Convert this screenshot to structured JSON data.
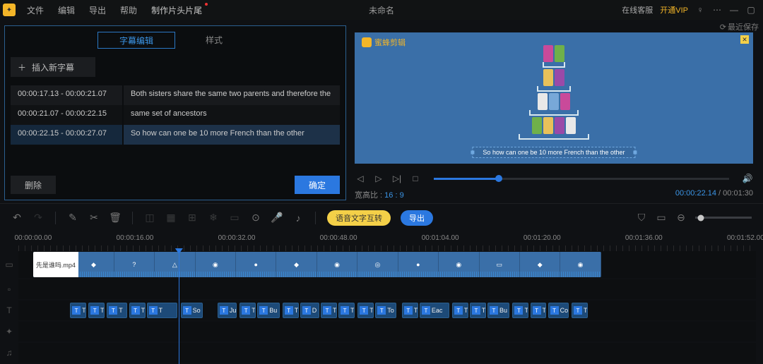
{
  "titlebar": {
    "menus": [
      "文件",
      "编辑",
      "导出",
      "帮助",
      "制作片头片尾"
    ],
    "doc_title": "未命名",
    "right": {
      "service": "在线客服",
      "vip": "开通VIP"
    }
  },
  "recent_save": "最近保存",
  "subtitle_panel": {
    "tabs": {
      "edit": "字幕编辑",
      "style": "样式"
    },
    "insert": "插入新字幕",
    "rows": [
      {
        "time": "00:00:17.13 - 00:00:21.07",
        "text": "Both sisters share the same two parents and therefore the"
      },
      {
        "time": "00:00:21.07 - 00:00:22.15",
        "text": "same set of ancestors"
      },
      {
        "time": "00:00:22.15 - 00:00:27.07",
        "text": "So how can one be 10 more French than the other"
      }
    ],
    "delete": "删除",
    "confirm": "确定"
  },
  "preview": {
    "watermark": "蜜蜂剪辑",
    "caption": "So how can one be 10 more French than the other"
  },
  "player": {
    "aspect_label": "宽高比",
    "aspect_value": "16 : 9",
    "current": "00:00:22.14",
    "total": "00:01:30"
  },
  "toolbar": {
    "voice_text": "语音文字互转",
    "export": "导出"
  },
  "ruler": [
    {
      "t": "00:00:00.00",
      "pct": 2
    },
    {
      "t": "00:00:16.00",
      "pct": 15.8
    },
    {
      "t": "00:00:32.00",
      "pct": 29.6
    },
    {
      "t": "00:00:48.00",
      "pct": 43.4
    },
    {
      "t": "00:01:04.00",
      "pct": 57.2
    },
    {
      "t": "00:01:20.00",
      "pct": 71.0
    },
    {
      "t": "00:01:36.00",
      "pct": 84.8
    },
    {
      "t": "00:01:52.00",
      "pct": 98.6
    }
  ],
  "playhead_pct": 21.2,
  "video_track": {
    "label": "先是谁吗.mp4",
    "start_pct": 2,
    "width_pct": 77
  },
  "text_clips": [
    {
      "l": 7,
      "w": 2.2,
      "t": "T"
    },
    {
      "l": 9.5,
      "w": 2.2,
      "t": "T"
    },
    {
      "l": 12,
      "w": 2.8,
      "t": "T"
    },
    {
      "l": 15,
      "w": 2.2,
      "t": "T"
    },
    {
      "l": 17.4,
      "w": 4.2,
      "t": "T"
    },
    {
      "l": 22,
      "w": 3,
      "t": "So"
    },
    {
      "l": 27,
      "w": 2.6,
      "t": "Ju"
    },
    {
      "l": 30,
      "w": 2.2,
      "t": "T"
    },
    {
      "l": 32.4,
      "w": 3,
      "t": "Bu"
    },
    {
      "l": 35.8,
      "w": 2.2,
      "t": "T"
    },
    {
      "l": 38.2,
      "w": 2.6,
      "t": "D"
    },
    {
      "l": 41,
      "w": 2.2,
      "t": "T"
    },
    {
      "l": 43.4,
      "w": 2.2,
      "t": "T"
    },
    {
      "l": 46,
      "w": 2.2,
      "t": "T"
    },
    {
      "l": 48.4,
      "w": 2.8,
      "t": "To"
    },
    {
      "l": 52,
      "w": 2.2,
      "t": "T"
    },
    {
      "l": 54.4,
      "w": 4,
      "t": "Eac"
    },
    {
      "l": 58.8,
      "w": 2.2,
      "t": "T"
    },
    {
      "l": 61.2,
      "w": 2.2,
      "t": "T"
    },
    {
      "l": 63.6,
      "w": 3,
      "t": "Bu"
    },
    {
      "l": 67,
      "w": 2.2,
      "t": "T"
    },
    {
      "l": 69.4,
      "w": 2.2,
      "t": "T"
    },
    {
      "l": 71.8,
      "w": 2.8,
      "t": "Co"
    },
    {
      "l": 75,
      "w": 2.2,
      "t": "T"
    }
  ]
}
